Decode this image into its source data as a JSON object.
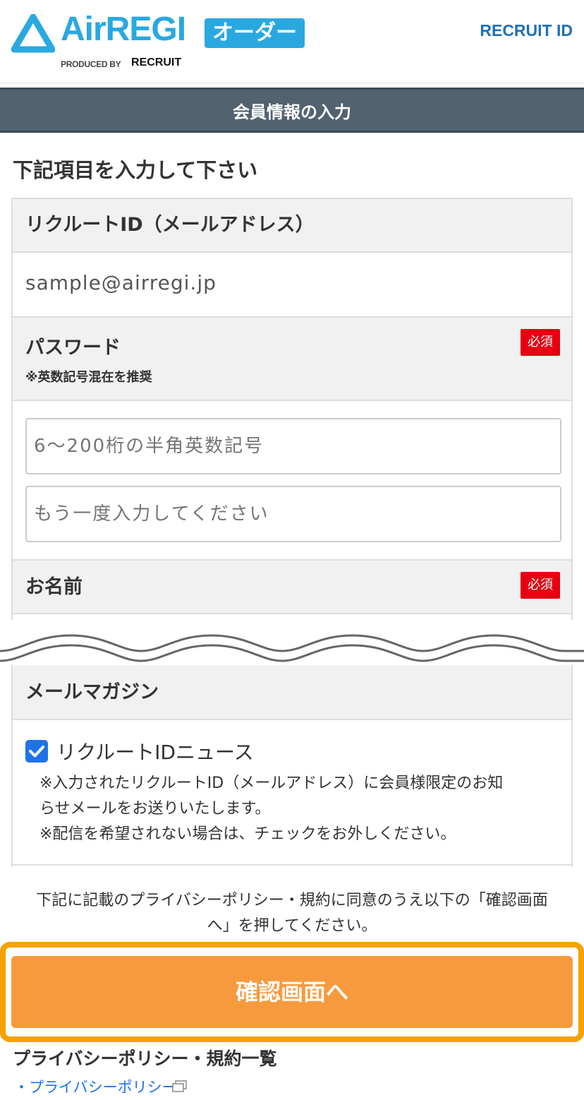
{
  "header": {
    "logo_text": "AirREGI",
    "order_badge": "オーダー",
    "produced_by": "PRODUCED BY",
    "produced_brand": "RECRUIT",
    "recruit_id_logo": "RECRUIT ID"
  },
  "page_title": "会員情報の入力",
  "intro": "下記項目を入力して下さい",
  "sections": {
    "recruit_id": {
      "label": "リクルートID（メールアドレス）",
      "value": "sample@airregi.jp"
    },
    "password": {
      "label": "パスワード",
      "note": "※英数記号混在を推奨",
      "required": "必須",
      "placeholder": "6〜200桁の半角英数記号",
      "confirm_placeholder": "もう一度入力してください"
    },
    "name": {
      "label": "お名前",
      "required": "必須"
    },
    "mail_magazine": {
      "label": "メールマガジン",
      "checkbox_label": "リクルートIDニュース",
      "checked": true,
      "note_line1": "※入力されたリクルートID（メールアドレス）に会員様限定のお知",
      "note_line2": "らせメールをお送りいたします。",
      "note_line3": "※配信を希望されない場合は、チェックをお外しください。"
    }
  },
  "agreement": {
    "line1": "下記に記載のプライバシーポリシー・規約に同意のうえ以下の「確認画面",
    "line2": "へ」を押してください。"
  },
  "confirm_button": "確認画面へ",
  "policy": {
    "title": "プライバシーポリシー・規約一覧",
    "link": "・プライバシーポリシー"
  },
  "colors": {
    "brand": "#29a8e0",
    "title_bar": "#526270",
    "required": "#e60012",
    "button": "#f79a3e",
    "highlight": "#f6a200",
    "link": "#1e73e8"
  }
}
